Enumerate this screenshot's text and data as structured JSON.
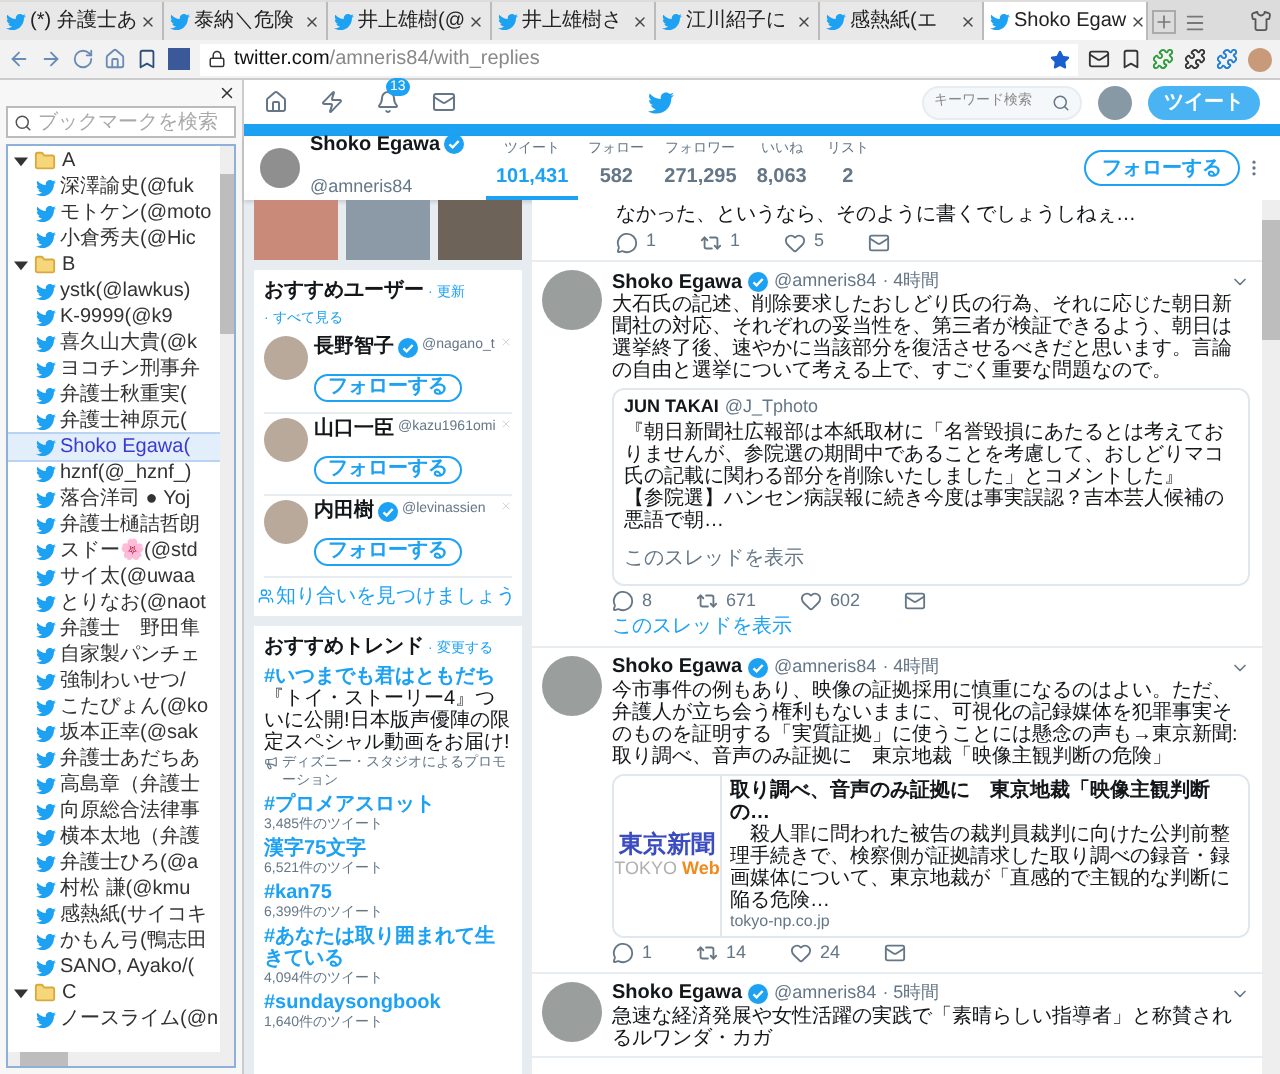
{
  "browser": {
    "tabs": [
      {
        "title": "(*) 弁護士あ",
        "selected": false
      },
      {
        "title": "泰納＼危険",
        "selected": false
      },
      {
        "title": "井上雄樹(@",
        "selected": false
      },
      {
        "title": "井上雄樹さ",
        "selected": false
      },
      {
        "title": "江川紹子に",
        "selected": false
      },
      {
        "title": "感熱紙(エ",
        "selected": false
      },
      {
        "title": "Shoko Egaw",
        "selected": true
      }
    ],
    "url_host": "twitter.com",
    "url_path": "/amneris84/with_replies"
  },
  "bookmarks_sidebar": {
    "search_placeholder": "ブックマークを検索",
    "tree": [
      {
        "label": "A",
        "expanded": true,
        "children": [
          {
            "label": "深澤諭史(@fuk",
            "selected": false
          },
          {
            "label": "モトケン(@moto",
            "selected": false
          },
          {
            "label": "小倉秀夫(@Hic",
            "selected": false
          }
        ]
      },
      {
        "label": "B",
        "expanded": true,
        "children": [
          {
            "label": "ystk(@lawkus)",
            "selected": false
          },
          {
            "label": "K-9999(@k9",
            "selected": false
          },
          {
            "label": "喜久山大貴(@k",
            "selected": false
          },
          {
            "label": "ヨコチン刑事弁",
            "selected": false
          },
          {
            "label": "弁護士秋重実(",
            "selected": false
          },
          {
            "label": "弁護士神原元(",
            "selected": false
          },
          {
            "label": "Shoko Egawa(",
            "selected": true
          },
          {
            "label": "hznf(@_hznf_)",
            "selected": false
          },
          {
            "label": "落合洋司 ● Yoj",
            "selected": false
          },
          {
            "label": "弁護士樋詰哲朗",
            "selected": false
          },
          {
            "label": "スドー🌸(@std",
            "selected": false
          },
          {
            "label": "サイ太(@uwaa",
            "selected": false
          },
          {
            "label": "とりなお(@naot",
            "selected": false
          },
          {
            "label": "弁護士　野田隼",
            "selected": false
          },
          {
            "label": "自家製パンチェ",
            "selected": false
          },
          {
            "label": "強制わいせつ/",
            "selected": false
          },
          {
            "label": "こたぴょん(@ko",
            "selected": false
          },
          {
            "label": "坂本正幸(@sak",
            "selected": false
          },
          {
            "label": "弁護士あだちあ",
            "selected": false
          },
          {
            "label": "高島章（弁護士",
            "selected": false
          },
          {
            "label": "向原総合法律事",
            "selected": false
          },
          {
            "label": "横本太地（弁護",
            "selected": false
          },
          {
            "label": "弁護士ひろ(@a",
            "selected": false
          },
          {
            "label": "村松 謙(@kmu",
            "selected": false
          },
          {
            "label": "感熱紙(サイコキ",
            "selected": false
          },
          {
            "label": "かもん弓(鴨志田",
            "selected": false
          },
          {
            "label": "SANO, Ayako/(",
            "selected": false
          }
        ]
      },
      {
        "label": "C",
        "expanded": true,
        "children": [
          {
            "label": "ノースライム(@n",
            "selected": false
          }
        ]
      }
    ]
  },
  "twitter_nav": {
    "notification_count": "13",
    "search_placeholder": "キーワード検索",
    "tweet_button": "ツイート"
  },
  "profile": {
    "name": "Shoko Egawa",
    "verified": true,
    "handle": "@amneris84",
    "stats": [
      {
        "label": "ツイート",
        "value": "101,431",
        "selected": true
      },
      {
        "label": "フォロー",
        "value": "582",
        "selected": false
      },
      {
        "label": "フォロワー",
        "value": "271,295",
        "selected": false
      },
      {
        "label": "いいね",
        "value": "8,063",
        "selected": false
      },
      {
        "label": "リスト",
        "value": "2",
        "selected": false
      }
    ],
    "follow_button": "フォローする"
  },
  "who_to_follow": {
    "title": "おすすめユーザー",
    "links": [
      "· 更新",
      "· すべて見る"
    ],
    "users": [
      {
        "name": "長野智子",
        "verified": true,
        "handle": "@nagano_t",
        "button": "フォローする"
      },
      {
        "name": "山口一臣",
        "verified": false,
        "handle": "@kazu1961omi",
        "button": "フォローする"
      },
      {
        "name": "内田樹",
        "verified": true,
        "handle": "@levinassien",
        "button": "フォローする"
      }
    ],
    "find_friends": "知り合いを見つけましょう"
  },
  "trends": {
    "title": "おすすめトレンド",
    "change_link": "· 変更する",
    "items": [
      {
        "kind": "promoted",
        "name": "#いつまでも君はともだち",
        "description": "『トイ・ストーリー4』ついに公開!日本版声優陣の限定スペシャル動画をお届け!",
        "promoter": "ディズニー・スタジオによるプロモーション"
      },
      {
        "kind": "trend",
        "name": "#プロメアスロット",
        "count": "3,485件のツイート"
      },
      {
        "kind": "trend",
        "name": "漢字75文字",
        "count": "6,521件のツイート"
      },
      {
        "kind": "trend",
        "name": "#kan75",
        "count": "6,399件のツイート"
      },
      {
        "kind": "trend",
        "name": "#あなたは取り囲まれて生きている",
        "count": "4,094件のツイート"
      },
      {
        "kind": "trend",
        "name": "#sundaysongbook",
        "count": "1,640件のツイート"
      }
    ]
  },
  "timeline": [
    {
      "kind": "continued",
      "text": "なかった、というなら、そのように書くでしょうしねぇ…",
      "replies": "1",
      "retweets": "1",
      "likes": "5"
    },
    {
      "kind": "quote",
      "name": "Shoko Egawa",
      "verified": true,
      "handle": "@amneris84",
      "time": "· 4時間",
      "text": "大石氏の記述、削除要求したおしどり氏の行為、それに応じた朝日新聞社の対応、それぞれの妥当性を、第三者が検証できるよう、朝日は選挙終了後、速やかに当該部分を復活させるべきだと思います。言論の自由と選挙について考える上で、すごく重要な問題なので。",
      "quote": {
        "name": "JUN TAKAI",
        "handle": "@J_Tphoto",
        "paragraphs": [
          "『朝日新聞社広報部は本紙取材に「名誉毀損にあたるとは考えておりませんが、参院選の期間中であることを考慮して、おしどりマコ氏の記載に関わる部分を削除いたしました」とコメントした』",
          "【参院選】ハンセン病誤報に続き今度は事実誤認？吉本芸人候補の悪語で朝…"
        ],
        "link": "このスレッドを表示"
      },
      "replies": "8",
      "retweets": "671",
      "likes": "602",
      "thread_link": "このスレッドを表示"
    },
    {
      "kind": "card",
      "name": "Shoko Egawa",
      "verified": true,
      "handle": "@amneris84",
      "time": "· 4時間",
      "text": "今市事件の例もあり、映像の証拠採用に慎重になるのはよい。ただ、弁護人が立ち会う権利もないままに、可視化の記録媒体を犯罪事実そのものを証明する「実質証拠」に使うことには懸念の声も→東京新聞:取り調べ、音声のみ証拠に　東京地裁「映像主観判断の危険」",
      "card": {
        "logo_main": "東京新聞",
        "logo_sub": "TOKYO",
        "logo_accent": "Web",
        "title": "取り調べ、音声のみ証拠に　東京地裁「映像主観判断の…",
        "description": "　殺人罪に問われた被告の裁判員裁判に向けた公判前整理手続きで、検察側が証拠請求した取り調べの録音・録画媒体について、東京地裁が「直感的で主観的な判断に陥る危険…",
        "domain": "tokyo-np.co.jp"
      },
      "replies": "1",
      "retweets": "14",
      "likes": "24"
    },
    {
      "kind": "plain",
      "name": "Shoko Egawa",
      "verified": true,
      "handle": "@amneris84",
      "time": "· 5時間",
      "text": "急速な経済発展や女性活躍の実践で「素晴らしい指導者」と称賛されるルワンダ・カガ"
    }
  ]
}
